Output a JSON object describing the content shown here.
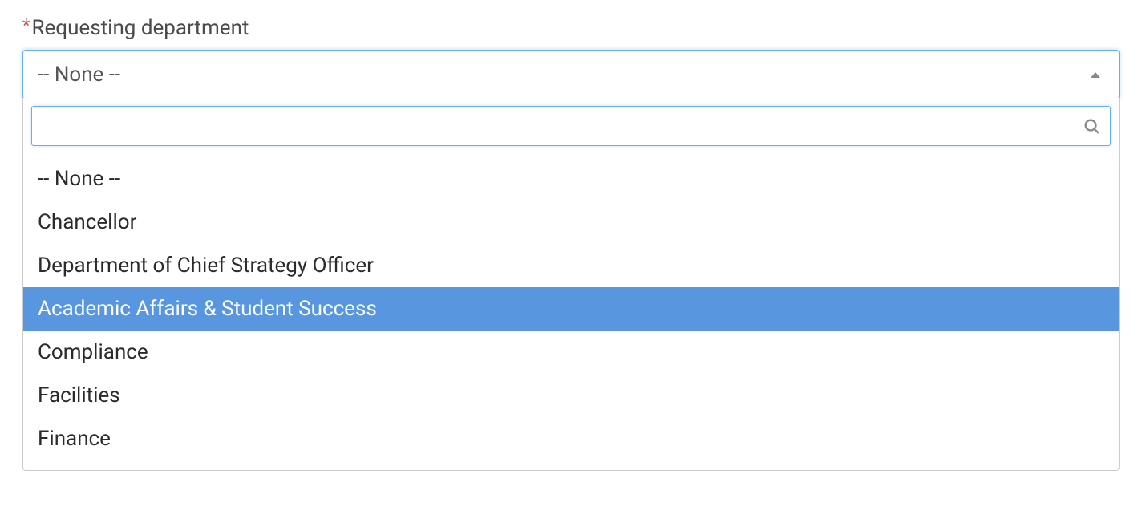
{
  "field": {
    "label": "Requesting department",
    "required_marker": "*",
    "selected_value": "-- None --",
    "search_value": "",
    "options": [
      {
        "label": "-- None --",
        "highlighted": false
      },
      {
        "label": "Chancellor",
        "highlighted": false
      },
      {
        "label": "Department of Chief Strategy Officer",
        "highlighted": false
      },
      {
        "label": "Academic Affairs & Student Success",
        "highlighted": true
      },
      {
        "label": "Compliance",
        "highlighted": false
      },
      {
        "label": "Facilities",
        "highlighted": false
      },
      {
        "label": "Finance",
        "highlighted": false
      }
    ]
  },
  "colors": {
    "highlight_bg": "#5897e0",
    "focus_border": "#66afe9"
  }
}
